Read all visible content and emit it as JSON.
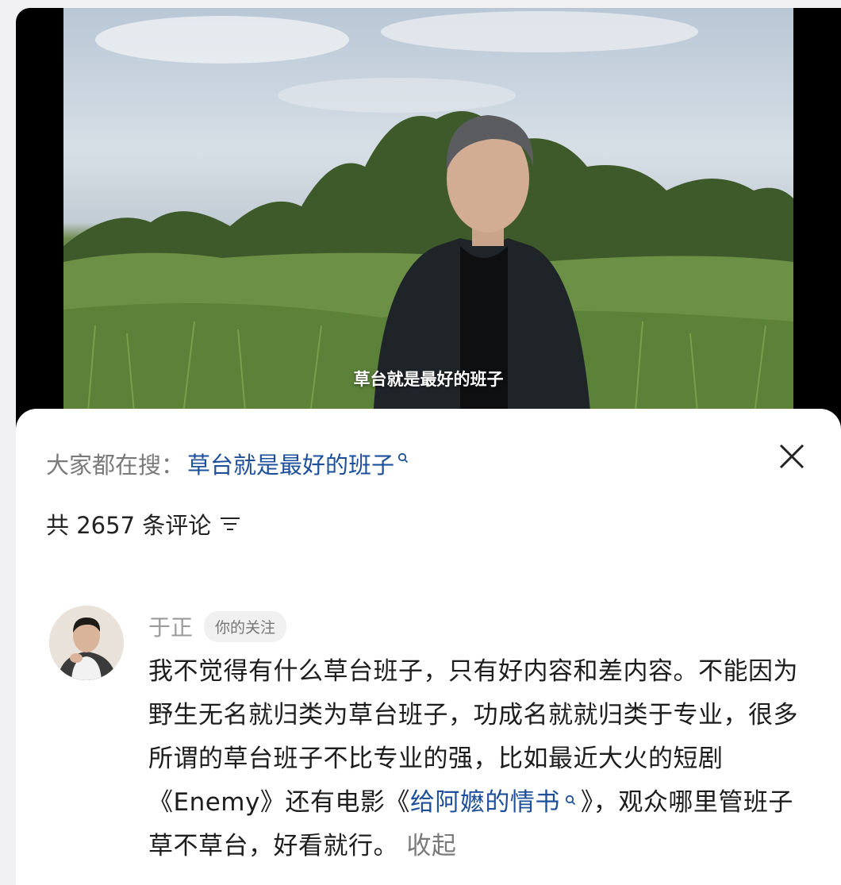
{
  "video": {
    "subtitle": "草台就是最好的班子"
  },
  "sheet": {
    "search_prefix": "大家都在搜：",
    "search_term": "草台就是最好的班子",
    "comment_count_text": "共 2657 条评论",
    "close_icon": "close-icon",
    "sort_icon": "filter-icon"
  },
  "comment": {
    "author": "于正",
    "tag": "你的关注",
    "text_part1": "我不觉得有什么草台班子，只有好内容和差内容。不能因为野生无名就归类为草台班子，功成名就就归类于专业，很多所谓的草台班子不比专业的强，比如最近大火的短剧《Enemy》还有电影《",
    "link_text": "给阿嬷的情书",
    "text_part2": "》，观众哪里管班子草不草台，好看就行。",
    "collapse_label": "收起"
  },
  "colors": {
    "link": "#1e4f9a",
    "muted": "#7a7a7a",
    "text": "#1d1d1d"
  }
}
